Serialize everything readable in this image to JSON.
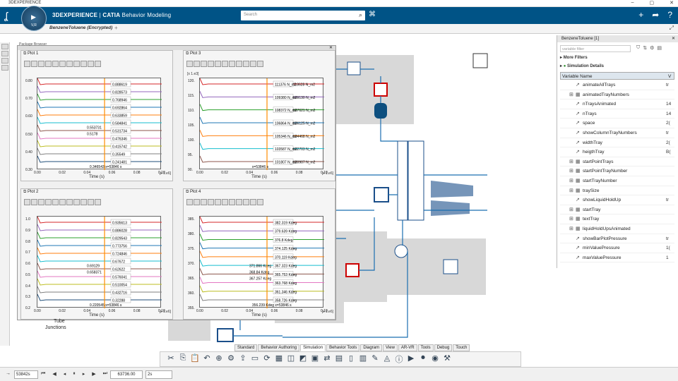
{
  "window": {
    "title": "3DEXPERIENCE"
  },
  "header": {
    "brand": "3DEXPERIENCE",
    "separator": "|",
    "product": "CATIA",
    "module": "Behavior Modeling",
    "compass_version": "V,R",
    "search_placeholder": "Search"
  },
  "tabs": {
    "document": "BenzeneToluene (Encrypted)"
  },
  "package_browser": "Package Browser",
  "plots": [
    {
      "title": "Plot 1",
      "xlabel": "Time (s)",
      "scale": "[x 1.e6]",
      "xticks": [
        "0.00",
        "0.02",
        "0.04",
        "0.06",
        "0.08",
        "0.10"
      ],
      "yticks": [
        "0.80",
        "0.70",
        "0.60",
        "0.50",
        "0.40",
        "0.30"
      ],
      "labels": [
        "0.888619",
        "0.828573",
        "0.768946",
        "0.692864",
        "0.633859",
        "0.584841",
        "0.531734",
        "0.476346",
        "0.415742",
        "0.35549",
        "0.241481"
      ],
      "left_labels": [
        "0.553731",
        "0.5178"
      ],
      "cursor": "0.346543|x=53846 s"
    },
    {
      "title": "Plot 3",
      "xlabel": "Time (s)",
      "scale": "[x 1.e6]",
      "yscale": "[x 1.e3]",
      "xticks": [
        "0.00",
        "0.02",
        "0.04",
        "0.06",
        "0.08",
        "0.10"
      ],
      "yticks": [
        "120.",
        "115.",
        "110.",
        "105.",
        "100.",
        "95.",
        "90."
      ],
      "labels": [
        "111376 N_m2",
        "109380 N_m2",
        "108372 N_m2",
        "106864 N_m2",
        "105346 N_m2",
        "103587 N_m2",
        "101807 N_m2"
      ],
      "right_labels": [
        "118628 N_m2",
        "109130 N_m2",
        "107621 N_m2",
        "106125 N_m2",
        "104468 N_m2",
        "102703 N_m2",
        "100907 N_m2"
      ],
      "cursor": "x=53846 s"
    },
    {
      "title": "Plot 2",
      "xlabel": "Time (s)",
      "scale": "[x 1.e6]",
      "xticks": [
        "0.00",
        "0.02",
        "0.04",
        "0.06",
        "0.08",
        "0.10"
      ],
      "yticks": [
        "1.0",
        "0.9",
        "0.8",
        "0.7",
        "0.6",
        "0.5",
        "0.4",
        "0.3",
        "0.2"
      ],
      "labels": [
        "0.935613",
        "0.886028",
        "0.829543",
        "0.773756",
        "0.724846",
        "0.67672",
        "0.62622",
        "0.576041",
        "0.510054",
        "0.432716",
        "0.32288"
      ],
      "left_labels": [
        "0.69129",
        "0.658371"
      ],
      "cursor": "0.220545|x=53846 s"
    },
    {
      "title": "Plot 4",
      "xlabel": "Time (s)",
      "scale": "[x 1.e6]",
      "xticks": [
        "0.00",
        "0.02",
        "0.04",
        "0.06",
        "0.08",
        "0.10"
      ],
      "yticks": [
        "385.",
        "380.",
        "375.",
        "370.",
        "365.",
        "360.",
        "355."
      ],
      "labels": [
        "382.319 Kdeg",
        "379.639 Kdeg",
        "376.8 Kdeg",
        "374.125 Kdeg",
        "370.119 Kdeg",
        "367.323 Kdeg",
        "365.753 Kdeg",
        "363.768 Kdeg",
        "361.346 Kdeg",
        "358.726 Kdeg"
      ],
      "left_labels": [
        "371.866 Kdeg",
        "368.84 Kdeg",
        "367.257 Kdeg"
      ],
      "cursor": "356.239 Kdeg|x=53846 s"
    }
  ],
  "tree_partial": [
    "Tube",
    "Junctions"
  ],
  "right_panel": {
    "title": "BenzeneToluene [1]",
    "filter_placeholder": "variable filter",
    "more_filters": "More Filters",
    "simulation_details": "Simulation Details",
    "col_name": "Variable Name",
    "col_value": "V",
    "rows": [
      {
        "name": "animateAllTrays",
        "value": "tr",
        "expand": false
      },
      {
        "name": "animatedTrayNumbers",
        "value": "",
        "expand": true
      },
      {
        "name": "nTraysAnimated",
        "value": "14",
        "expand": false
      },
      {
        "name": "nTrays",
        "value": "14",
        "expand": false
      },
      {
        "name": "space",
        "value": "2(",
        "expand": false
      },
      {
        "name": "showColumnTrayNumbers",
        "value": "tr",
        "expand": false
      },
      {
        "name": "widthTray",
        "value": "2(",
        "expand": false
      },
      {
        "name": "heigthTray",
        "value": "B(",
        "expand": false
      },
      {
        "name": "startPointTrays",
        "value": "",
        "expand": true
      },
      {
        "name": "startPointTrayNumber",
        "value": "",
        "expand": true
      },
      {
        "name": "startTrayNumber",
        "value": "",
        "expand": true
      },
      {
        "name": "traySize",
        "value": "",
        "expand": true
      },
      {
        "name": "showLiquidHoldUp",
        "value": "tr",
        "expand": false
      },
      {
        "name": "startTray",
        "value": "",
        "expand": true
      },
      {
        "name": "textTray",
        "value": "",
        "expand": true
      },
      {
        "name": "liquidHoldUpsAnimated",
        "value": "",
        "expand": true
      },
      {
        "name": "showBarPlotPressure",
        "value": "tr",
        "expand": false
      },
      {
        "name": "minValuePressure",
        "value": "1(",
        "expand": false
      },
      {
        "name": "maxValuePressure",
        "value": "1",
        "expand": false
      }
    ]
  },
  "mode_tabs": [
    "Standard",
    "Behavior Authoring",
    "Simulation",
    "Behavior Tools",
    "Diagram",
    "View",
    "AR-VR",
    "Tools",
    "Debug",
    "Touch"
  ],
  "active_mode_tab": "Simulation",
  "bottom": {
    "time_field": "53842s",
    "current_time": "63736.00",
    "step": "2s"
  },
  "colors": {
    "header": "#005386",
    "cursor": "#ff8c00"
  }
}
